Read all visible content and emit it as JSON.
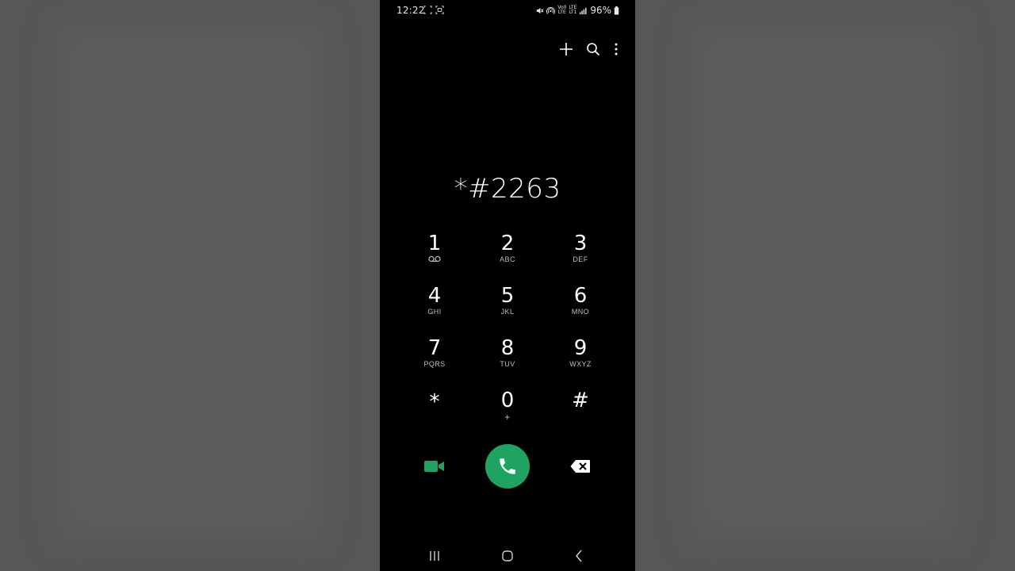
{
  "status_bar": {
    "time": "12:22",
    "battery": "96%",
    "volte": [
      "Vo0",
      "LTE"
    ],
    "lte": [
      "LTE",
      "LT1"
    ],
    "icons": [
      "screen-record-icon",
      "screenshot-icon",
      "mute-icon",
      "hotspot-icon",
      "volte-icon",
      "lte-icon",
      "signal-icon",
      "battery-icon"
    ]
  },
  "actions": [
    "add-icon",
    "search-icon",
    "more-options-icon"
  ],
  "dialer": {
    "number": "*#2263"
  },
  "keys": [
    {
      "digit": "1",
      "letters": ""
    },
    {
      "digit": "2",
      "letters": "ABC"
    },
    {
      "digit": "3",
      "letters": "DEF"
    },
    {
      "digit": "4",
      "letters": "GHI"
    },
    {
      "digit": "5",
      "letters": "JKL"
    },
    {
      "digit": "6",
      "letters": "MNO"
    },
    {
      "digit": "7",
      "letters": "PQRS"
    },
    {
      "digit": "8",
      "letters": "TUV"
    },
    {
      "digit": "9",
      "letters": "WXYZ"
    },
    {
      "digit": "*",
      "letters": ""
    },
    {
      "digit": "0",
      "letters": "+"
    },
    {
      "digit": "#",
      "letters": ""
    }
  ],
  "colors": {
    "background": "#000000",
    "accent_green": "#1fa363",
    "text": "#ffffff",
    "subtext": "#bdbdbd",
    "outer_background": "#575757"
  },
  "nav": [
    "recent-apps-icon",
    "home-icon",
    "back-icon"
  ]
}
